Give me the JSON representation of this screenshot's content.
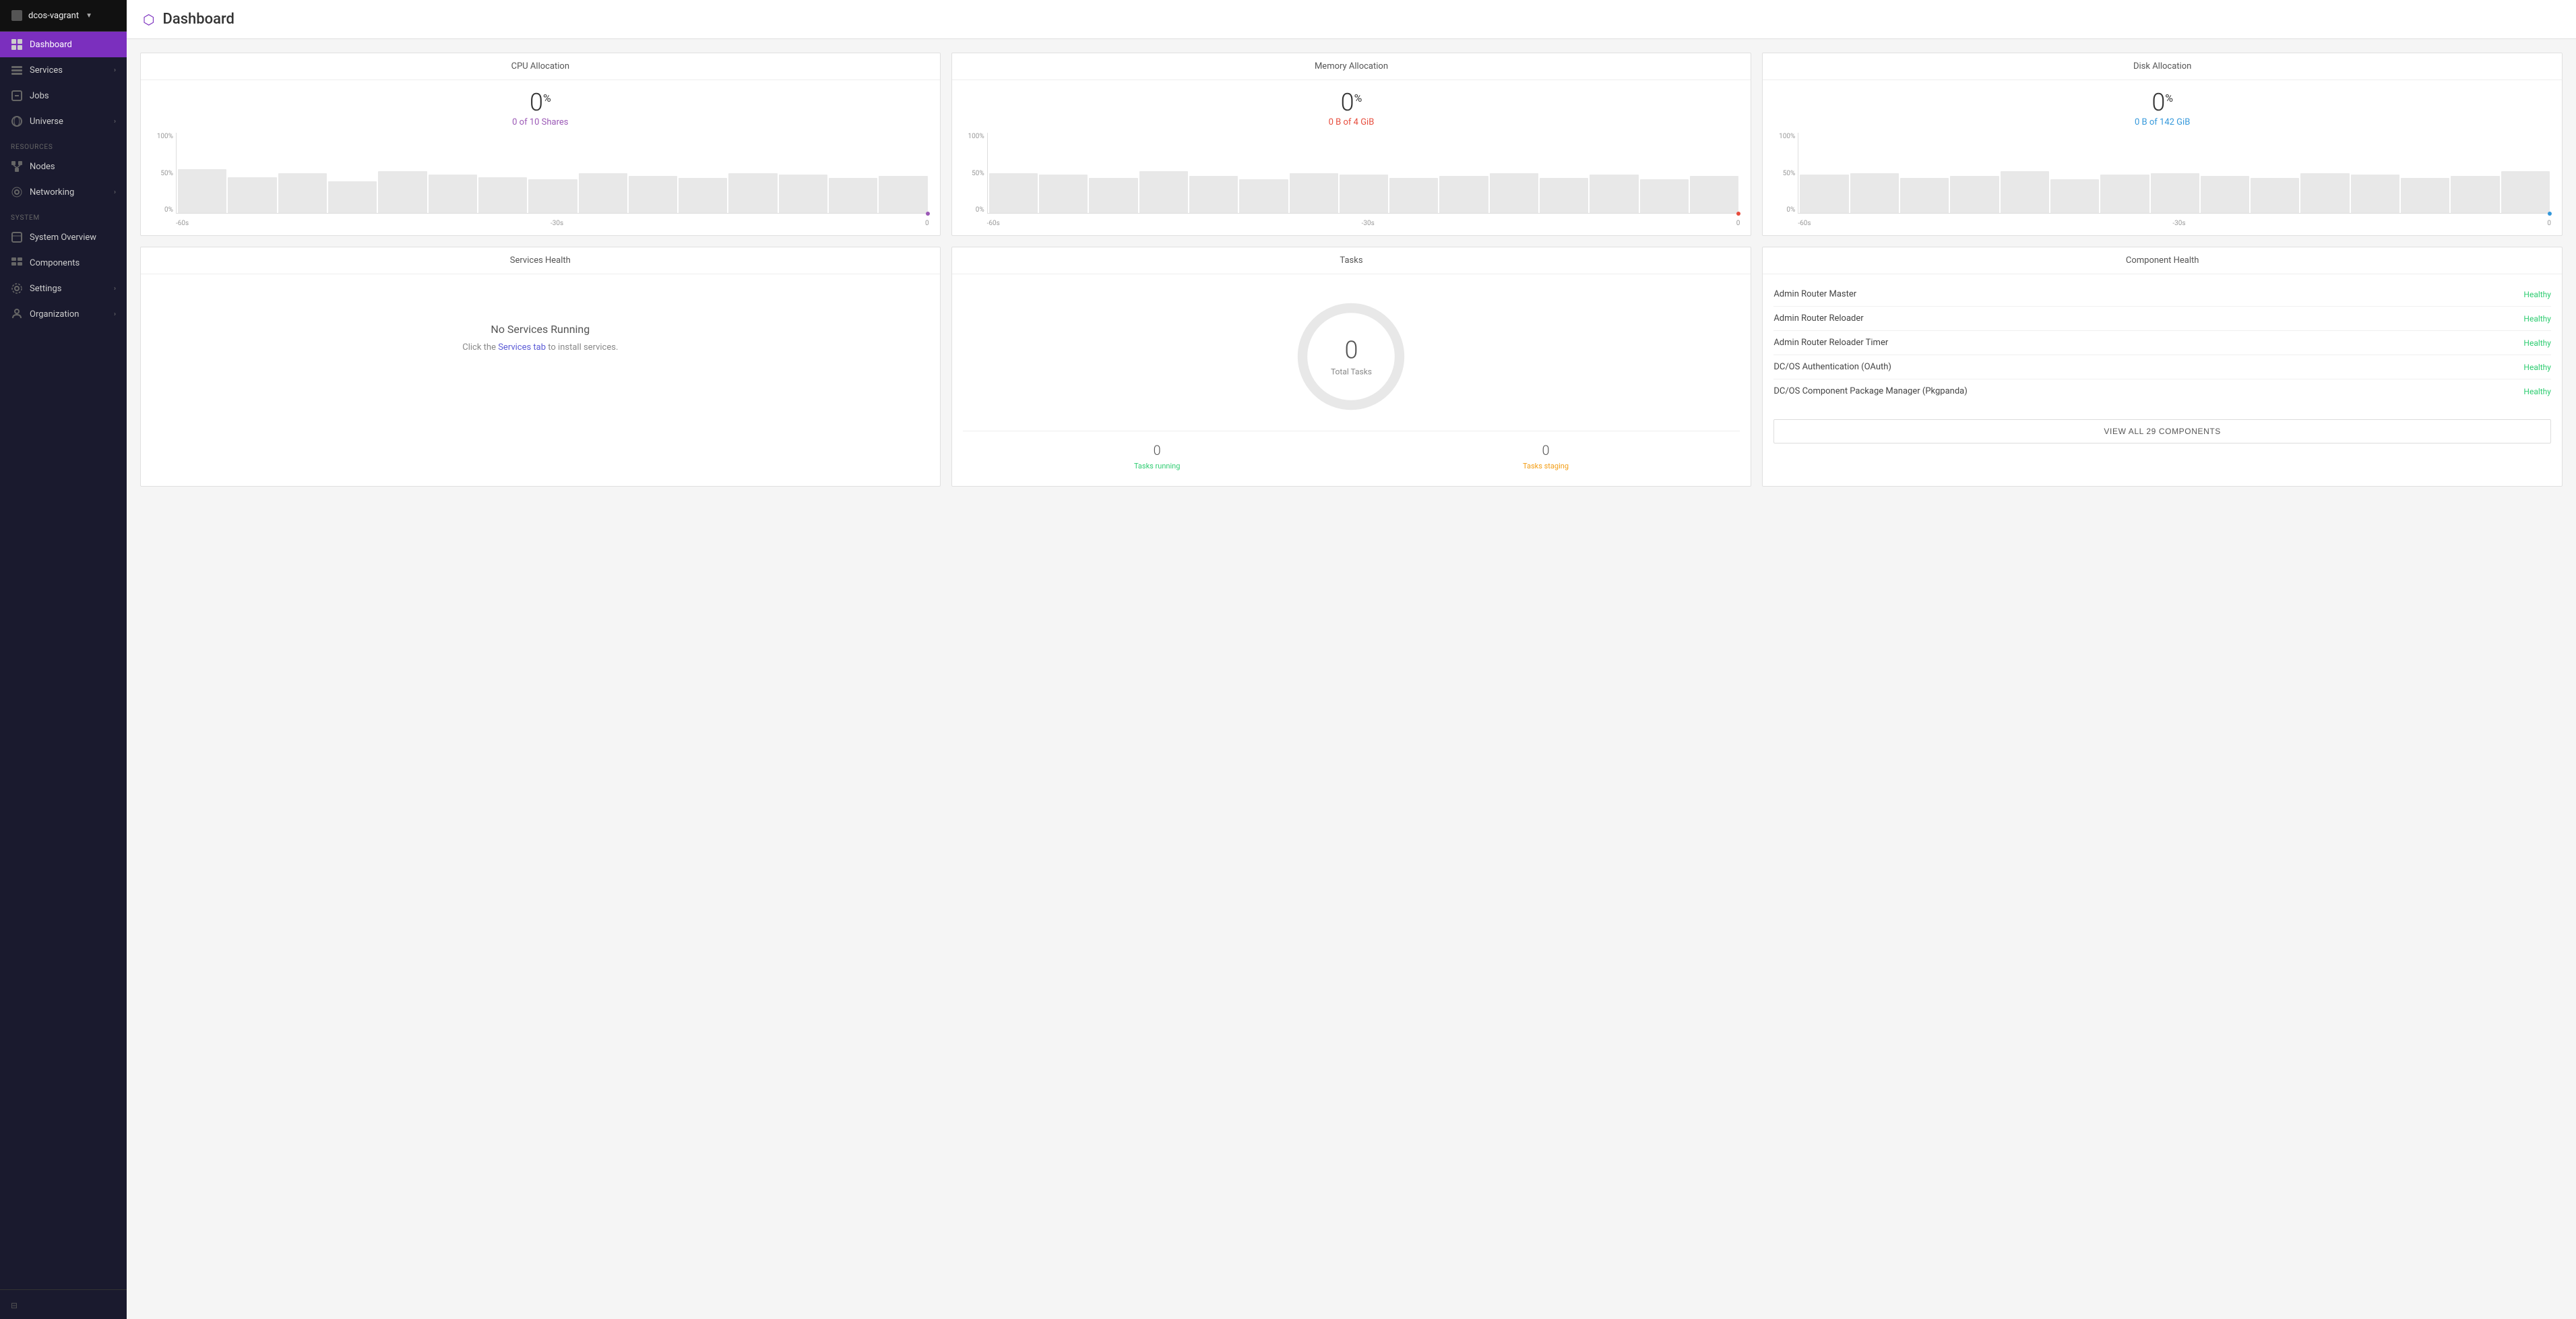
{
  "app": {
    "cluster_name": "dcos-vagrant",
    "title": "Dashboard",
    "shield_char": "⬡"
  },
  "sidebar": {
    "dashboard_label": "Dashboard",
    "services_label": "Services",
    "jobs_label": "Jobs",
    "universe_label": "Universe",
    "resources_section": "RESOURCES",
    "nodes_label": "Nodes",
    "networking_label": "Networking",
    "system_section": "SYSTEM",
    "system_overview_label": "System Overview",
    "components_label": "Components",
    "settings_label": "Settings",
    "organization_label": "Organization"
  },
  "cpu_card": {
    "title": "CPU Allocation",
    "pct": "0",
    "pct_sym": "%",
    "sub": "0 of 10 Shares",
    "sub_color": "purple",
    "y_top": "100%",
    "y_mid": "50%",
    "y_bot": "0%",
    "x_left": "-60s",
    "x_mid": "-30s",
    "x_right": "0",
    "bars": [
      55,
      45,
      50,
      40,
      52,
      48,
      45,
      42,
      50,
      46,
      44,
      50,
      48,
      44,
      46
    ],
    "dot_class": "dot-purple"
  },
  "memory_card": {
    "title": "Memory Allocation",
    "pct": "0",
    "pct_sym": "%",
    "sub": "0 B of 4 GiB",
    "sub_color": "red",
    "y_top": "100%",
    "y_mid": "50%",
    "y_bot": "0%",
    "x_left": "-60s",
    "x_mid": "-30s",
    "x_right": "0",
    "bars": [
      50,
      48,
      44,
      52,
      46,
      42,
      50,
      48,
      44,
      46,
      50,
      44,
      48,
      42,
      46
    ],
    "dot_class": "dot-red"
  },
  "disk_card": {
    "title": "Disk Allocation",
    "pct": "0",
    "pct_sym": "%",
    "sub": "0 B of 142 GiB",
    "sub_color": "blue",
    "y_top": "100%",
    "y_mid": "50%",
    "y_bot": "0%",
    "x_left": "-60s",
    "x_mid": "-30s",
    "x_right": "0",
    "bars": [
      48,
      50,
      44,
      46,
      52,
      42,
      48,
      50,
      46,
      44,
      50,
      48,
      44,
      46,
      52
    ],
    "dot_class": "dot-blue"
  },
  "services_health": {
    "title": "Services Health",
    "no_running": "No Services Running",
    "click_text": "Click the ",
    "link_text": "Services tab",
    "after_text": " to install services."
  },
  "tasks": {
    "title": "Tasks",
    "total": "0",
    "total_label": "Total Tasks",
    "running": "0",
    "running_label": "Tasks running",
    "staging": "0",
    "staging_label": "Tasks staging"
  },
  "component_health": {
    "title": "Component Health",
    "components": [
      {
        "name": "Admin Router Master",
        "status": "Healthy"
      },
      {
        "name": "Admin Router Reloader",
        "status": "Healthy"
      },
      {
        "name": "Admin Router Reloader Timer",
        "status": "Healthy"
      },
      {
        "name": "DC/OS Authentication (OAuth)",
        "status": "Healthy"
      },
      {
        "name": "DC/OS Component Package Manager (Pkgpanda)",
        "status": "Healthy"
      }
    ],
    "view_all_btn": "VIEW ALL 29 COMPONENTS"
  }
}
